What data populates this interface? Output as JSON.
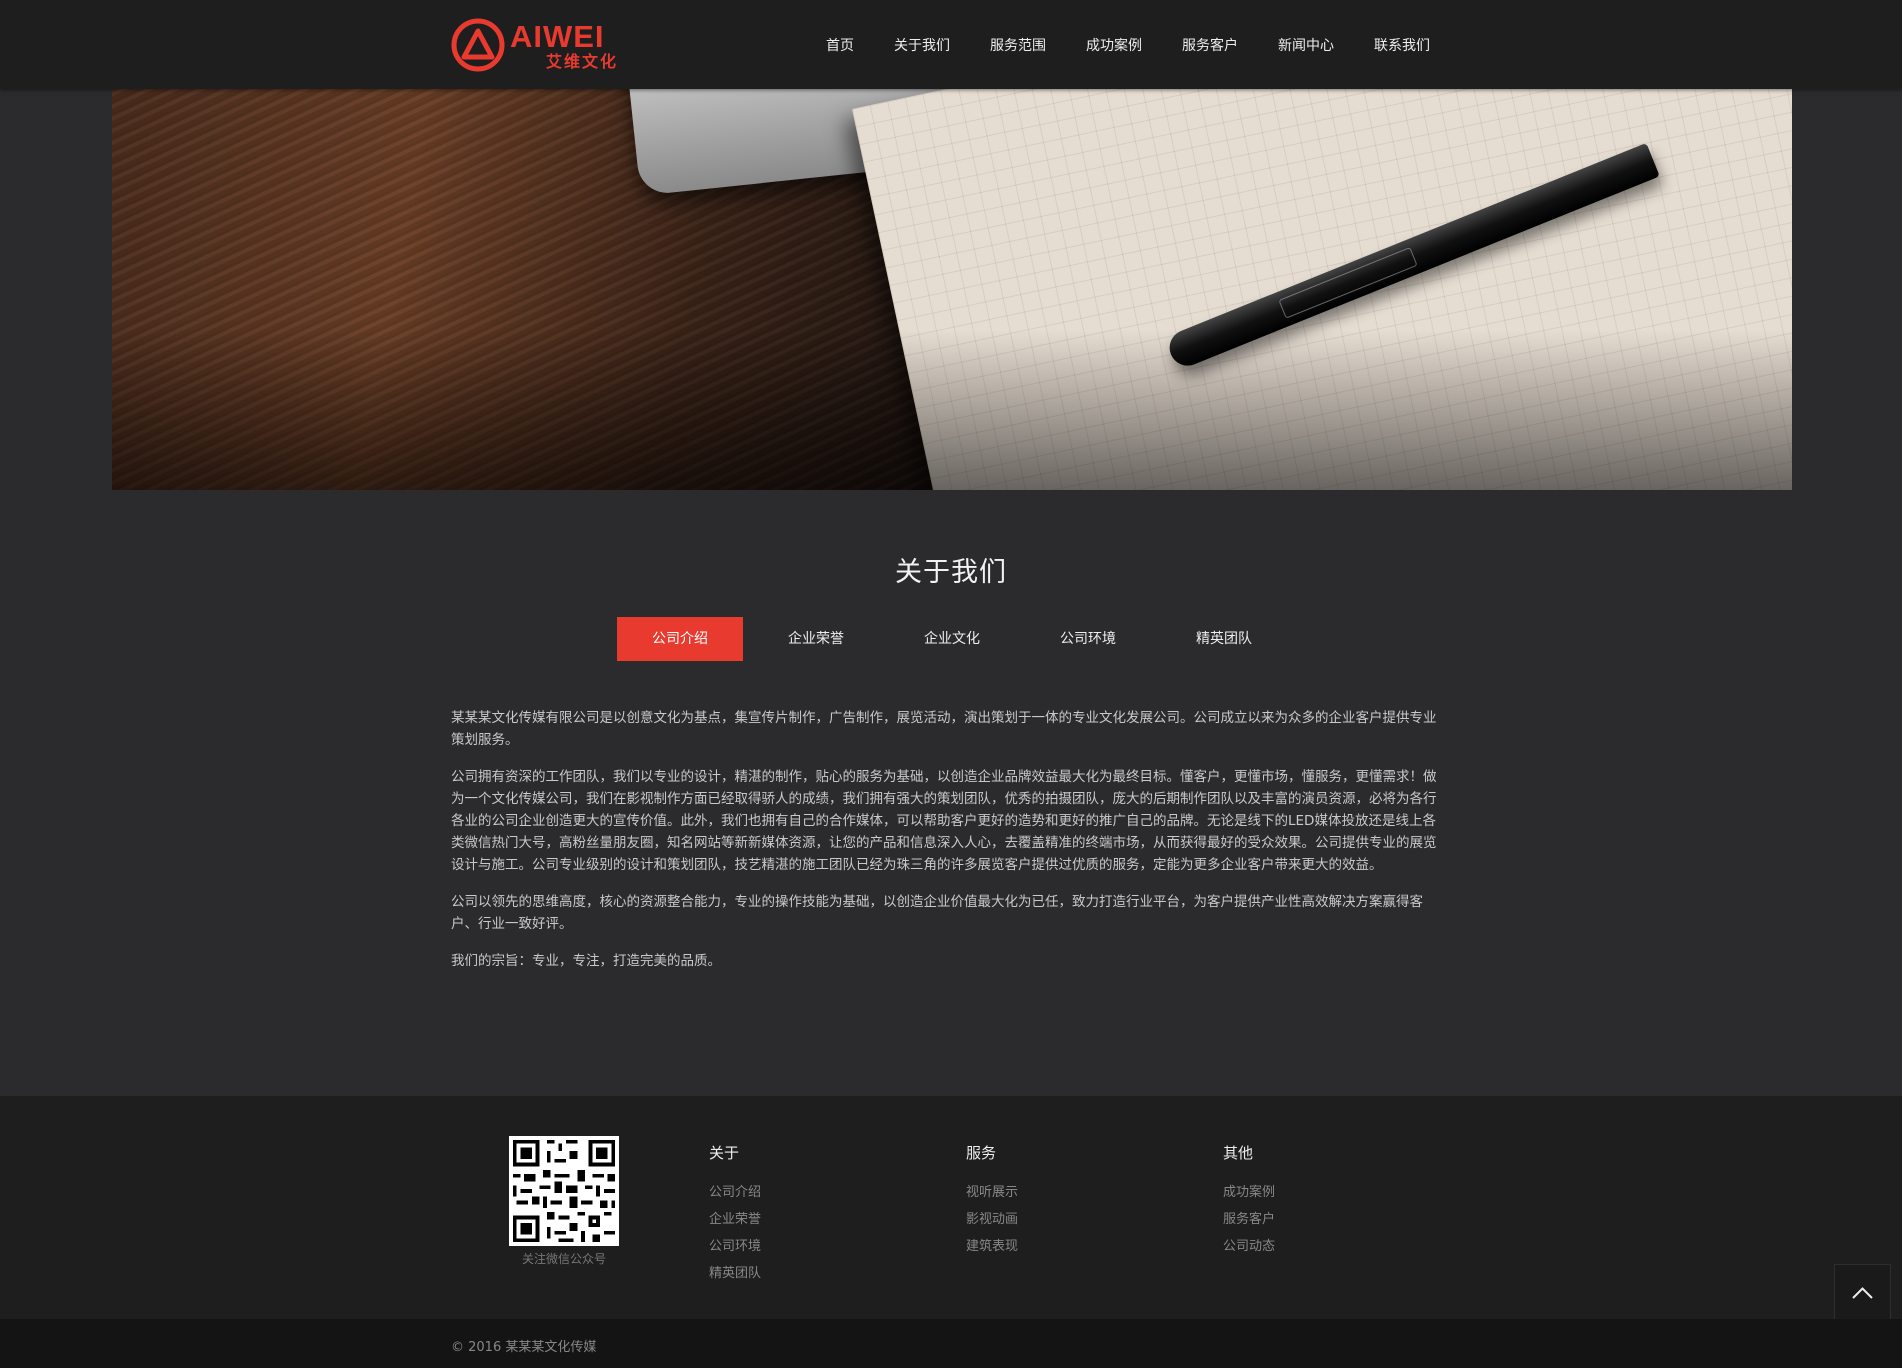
{
  "brand": {
    "name_en": "AIWEI",
    "name_cn": "艾维文化",
    "accent_color": "#e83a2f"
  },
  "nav": {
    "items": [
      "首页",
      "关于我们",
      "服务范围",
      "成功案例",
      "服务客户",
      "新闻中心",
      "联系我们"
    ]
  },
  "about": {
    "title": "关于我们",
    "tabs": [
      "公司介绍",
      "企业荣誉",
      "企业文化",
      "公司环境",
      "精英团队"
    ],
    "active_tab": "公司介绍",
    "paragraphs": [
      "某某某文化传媒有限公司是以创意文化为基点，集宣传片制作，广告制作，展览活动，演出策划于一体的专业文化发展公司。公司成立以来为众多的企业客户提供专业策划服务。",
      "公司拥有资深的工作团队，我们以专业的设计，精湛的制作，贴心的服务为基础，以创造企业品牌效益最大化为最终目标。懂客户，更懂市场，懂服务，更懂需求！做为一个文化传媒公司，我们在影视制作方面已经取得骄人的成绩，我们拥有强大的策划团队，优秀的拍摄团队，庞大的后期制作团队以及丰富的演员资源，必将为各行各业的公司企业创造更大的宣传价值。此外，我们也拥有自己的合作媒体，可以帮助客户更好的造势和更好的推广自己的品牌。无论是线下的LED媒体投放还是线上各类微信热门大号，高粉丝量朋友圈，知名网站等新新媒体资源，让您的产品和信息深入人心，去覆盖精准的终端市场，从而获得最好的受众效果。公司提供专业的展览设计与施工。公司专业级别的设计和策划团队，技艺精湛的施工团队已经为珠三角的许多展览客户提供过优质的服务，定能为更多企业客户带来更大的效益。",
      "公司以领先的思维高度，核心的资源整合能力，专业的操作技能为基础，以创造企业价值最大化为已任，致力打造行业平台，为客户提供产业性高效解决方案赢得客户、行业一致好评。",
      "我们的宗旨：专业，专注，打造完美的品质。"
    ]
  },
  "footer": {
    "qr_caption": "关注微信公众号",
    "columns": [
      {
        "title": "关于",
        "links": [
          "公司介绍",
          "企业荣誉",
          "公司环境",
          "精英团队"
        ]
      },
      {
        "title": "服务",
        "links": [
          "视听展示",
          "影视动画",
          "建筑表现"
        ]
      },
      {
        "title": "其他",
        "links": [
          "成功案例",
          "服务客户",
          "公司动态"
        ]
      }
    ],
    "copyright": "© 2016   某某某文化传媒"
  },
  "icons": {
    "to_top": "chevron-up-icon",
    "logo": "logo-a-triangle-icon"
  }
}
